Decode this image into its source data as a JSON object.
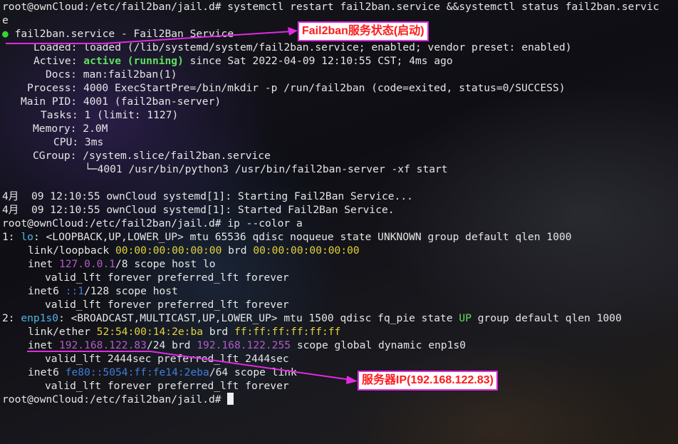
{
  "colors": {
    "prompt": "#e6e6e6",
    "active_green": "#5fe05f",
    "ip_magenta": "#b35cc9",
    "mac_yellow": "#e3d23b",
    "annotation_border": "#e02be0",
    "annotation_text": "#ff1a1a"
  },
  "lines": {
    "l1": "root@ownCloud:/etc/fail2ban/jail.d# systemctl restart fail2ban.service &&systemctl status fail2ban.servic",
    "l2": "e",
    "l3_dot": "●",
    "l3": " fail2ban.service - Fail2Ban Service",
    "l4": "Loaded: loaded (/lib/systemd/system/fail2ban.service; enabled; vendor preset: enabled)",
    "l5_pre": "Active: ",
    "l5_active": "active (running)",
    "l5_post": " since Sat 2022-04-09 12:10:55 CST; 4ms ago",
    "l6": "Docs: man:fail2ban(1)",
    "l7": "Process: 4000 ExecStartPre=/bin/mkdir -p /run/fail2ban (code=exited, status=0/SUCCESS)",
    "l8": "Main PID: 4001 (fail2ban-server)",
    "l9": "Tasks: 1 (limit: 1127)",
    "l10": "Memory: 2.0M",
    "l11": "CPU: 3ms",
    "l12": "CGroup: /system.slice/fail2ban.service",
    "l13": "└─4001 /usr/bin/python3 /usr/bin/fail2ban-server -xf start",
    "l14": "",
    "l15": "4月  09 12:10:55 ownCloud systemd[1]: Starting Fail2Ban Service...",
    "l16": "4月  09 12:10:55 ownCloud systemd[1]: Started Fail2Ban Service.",
    "l17": "root@ownCloud:/etc/fail2ban/jail.d# ip --color a",
    "l18_pre": "1: ",
    "l18_if": "lo",
    "l18_post": ": <LOOPBACK,UP,LOWER_UP> mtu 65536 qdisc noqueue state UNKNOWN group default qlen 1000",
    "l19_pre": "link/loopback ",
    "l19_mac": "00:00:00:00:00:00",
    "l19_mid": " brd ",
    "l19_brd": "00:00:00:00:00:00",
    "l20_pre": "inet ",
    "l20_ip": "127.0.0.1",
    "l20_post": "/8 scope host lo",
    "l21": "valid_lft forever preferred_lft forever",
    "l22_pre": "inet6 ",
    "l22_ip": "::1",
    "l22_post": "/128 scope host",
    "l23": "valid_lft forever preferred_lft forever",
    "l24_pre": "2: ",
    "l24_if": "enp1s0",
    "l24_mid": ": <BROADCAST,MULTICAST,UP,LOWER_UP> mtu 1500 qdisc fq_pie state ",
    "l24_up": "UP",
    "l24_post": " group default qlen 1000",
    "l25_pre": "link/ether ",
    "l25_mac": "52:54:00:14:2e:ba",
    "l25_mid": " brd ",
    "l25_brd": "ff:ff:ff:ff:ff:ff",
    "l26_pre": "inet ",
    "l26_ip": "192.168.122.83",
    "l26_mid": "/24 brd ",
    "l26_brd": "192.168.122.255",
    "l26_post": " scope global dynamic enp1s0",
    "l27": "valid_lft 2444sec preferred_lft 2444sec",
    "l28_pre": "inet6 ",
    "l28_ip": "fe80::5054:ff:fe14:2eba",
    "l28_post": "/64 scope link",
    "l29": "valid_lft forever preferred_lft forever",
    "l30": "root@ownCloud:/etc/fail2ban/jail.d# "
  },
  "annotations": {
    "status": "Fail2ban服务状态(启动)",
    "server_ip": "服务器IP(192.168.122.83)"
  }
}
